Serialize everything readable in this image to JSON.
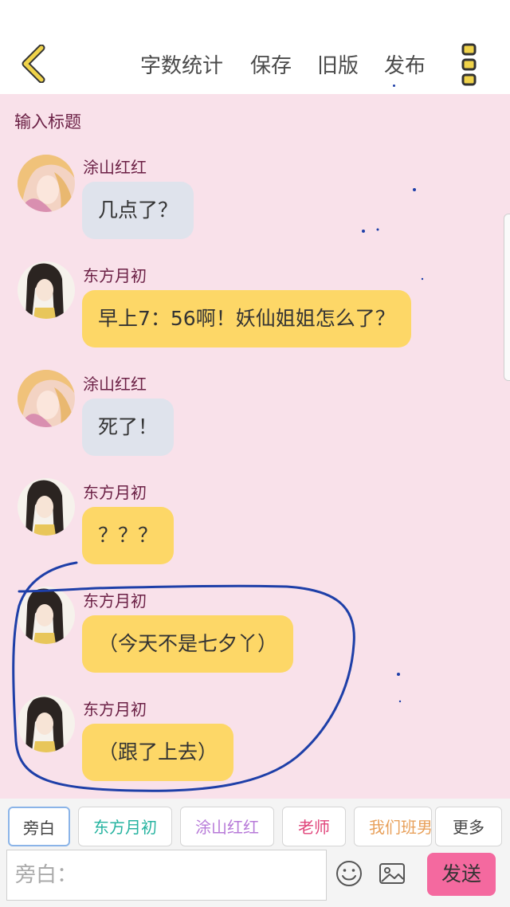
{
  "header": {
    "actions": [
      "字数统计",
      "保存",
      "旧版",
      "发布"
    ]
  },
  "title_placeholder": "输入标题",
  "messages": [
    {
      "sender": "涂山红红",
      "text": "几点了？",
      "avatar": "tushan-honghong-avatar",
      "bubble_color": "#dfe3ec"
    },
    {
      "sender": "东方月初",
      "text": "早上7：56啊！妖仙姐姐怎么了？",
      "avatar": "dongfang-yuechu-avatar",
      "bubble_color": "#fdd767"
    },
    {
      "sender": "涂山红红",
      "text": "死了！",
      "avatar": "tushan-honghong-avatar",
      "bubble_color": "#dfe3ec"
    },
    {
      "sender": "东方月初",
      "text": "？？？",
      "avatar": "dongfang-yuechu-avatar",
      "bubble_color": "#fdd767"
    },
    {
      "sender": "东方月初",
      "text": "（今天不是七夕丫）",
      "avatar": "dongfang-yuechu-avatar",
      "bubble_color": "#fdd767"
    },
    {
      "sender": "东方月初",
      "text": "（跟了上去）",
      "avatar": "dongfang-yuechu-avatar",
      "bubble_color": "#fdd767"
    }
  ],
  "characters": [
    {
      "label": "旁白",
      "color": "#444444",
      "selected": true
    },
    {
      "label": "东方月初",
      "color": "#26b3a0"
    },
    {
      "label": "涂山红红",
      "color": "#b77ad8"
    },
    {
      "label": "老师",
      "color": "#e0447a"
    },
    {
      "label": "我们班男",
      "color": "#e8a05a"
    }
  ],
  "more_label": "更多",
  "input": {
    "placeholder": "旁白：",
    "send_label": "发送"
  },
  "colors": {
    "background": "#f9e1ea",
    "accent": "#f4699f",
    "back_arrow": "#f0d34a",
    "annotation": "#1e3fa8"
  },
  "icons": [
    "chevron-left-icon",
    "more-vertical-icon",
    "emoji-icon",
    "image-icon"
  ]
}
